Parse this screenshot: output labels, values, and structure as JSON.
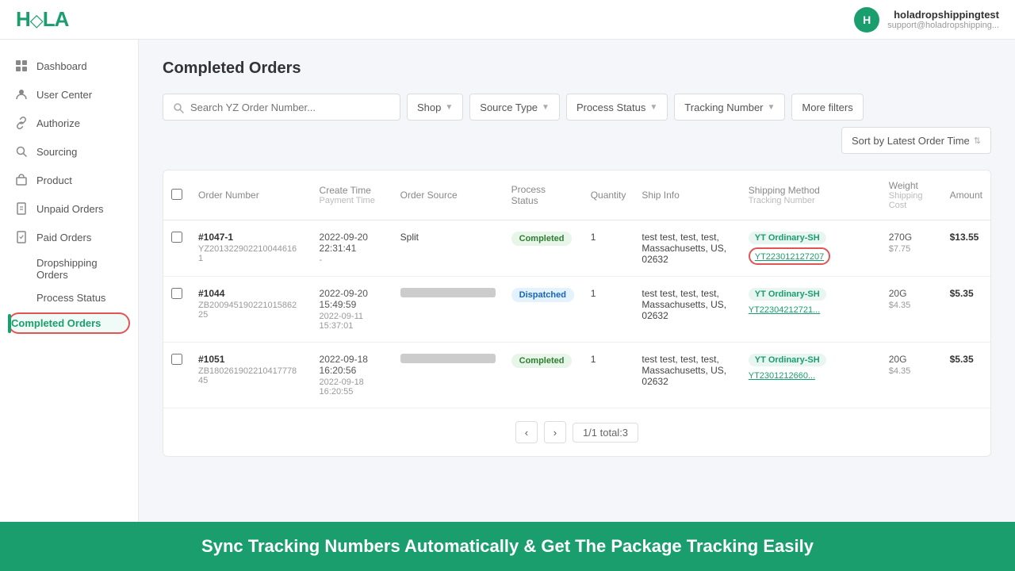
{
  "topbar": {
    "logo": "HOLA",
    "user": {
      "initial": "H",
      "name": "holadropshippingtest",
      "email": "support@holadropshipping..."
    }
  },
  "sidebar": {
    "items": [
      {
        "id": "dashboard",
        "label": "Dashboard",
        "icon": "grid"
      },
      {
        "id": "user-center",
        "label": "User Center",
        "icon": "user"
      },
      {
        "id": "authorize",
        "label": "Authorize",
        "icon": "link"
      },
      {
        "id": "sourcing",
        "label": "Sourcing",
        "icon": "search"
      },
      {
        "id": "product",
        "label": "Product",
        "icon": "box"
      },
      {
        "id": "unpaid-orders",
        "label": "Unpaid Orders",
        "icon": "file"
      },
      {
        "id": "paid-orders",
        "label": "Paid Orders",
        "icon": "check-file"
      }
    ],
    "sub_items": [
      {
        "id": "dropshipping-orders",
        "label": "Dropshipping Orders"
      },
      {
        "id": "process-status",
        "label": "Process Status"
      },
      {
        "id": "completed-orders",
        "label": "Completed Orders",
        "active": true
      }
    ]
  },
  "page": {
    "title": "Completed Orders"
  },
  "filters": {
    "search_placeholder": "Search YZ Order Number...",
    "shop_label": "Shop",
    "source_type_label": "Source Type",
    "process_status_label": "Process Status",
    "tracking_number_label": "Tracking Number",
    "more_filters_label": "More filters",
    "sort_label": "Sort by Latest Order Time"
  },
  "table": {
    "headers": {
      "order_number": "Order Number",
      "create_time": "Create Time",
      "payment_time": "Payment Time",
      "order_source": "Order Source",
      "process_status": "Process Status",
      "quantity": "Quantity",
      "ship_info": "Ship Info",
      "shipping_method": "Shipping Method",
      "tracking_number": "Tracking Number",
      "weight": "Weight",
      "shipping_cost": "Shipping Cost",
      "amount": "Amount"
    },
    "rows": [
      {
        "order_num": "#1047-1",
        "order_id": "YZ201322902210044616 1",
        "create_time": "2022-09-20 22:31:41",
        "payment_time": "-",
        "order_source": "Split",
        "status": "Completed",
        "status_type": "completed",
        "quantity": "1",
        "ship_info": "test test, test, test, Massachusetts, US, 02632",
        "ship_method": "YT Ordinary-SH",
        "tracking_num": "YT223012127207",
        "tracking_highlighted": true,
        "weight": "270G",
        "shipping_cost": "$7.75",
        "amount": "$13.55"
      },
      {
        "order_num": "#1044",
        "order_id": "ZB200945190221015862 25",
        "create_time": "2022-09-20 15:49:59",
        "payment_time": "2022-09-11 15:37:01",
        "order_source": "blurred",
        "status": "Dispatched",
        "status_type": "dispatched",
        "quantity": "1",
        "ship_info": "test test, test, test, Massachusetts, US, 02632",
        "ship_method": "YT Ordinary-SH",
        "tracking_num": "YT22304212721...",
        "tracking_highlighted": false,
        "weight": "20G",
        "shipping_cost": "$4.35",
        "amount": "$5.35"
      },
      {
        "order_num": "#1051",
        "order_id": "ZB180261902210417778 45",
        "create_time": "2022-09-18 16:20:56",
        "payment_time": "2022-09-18 16:20:55",
        "order_source": "blurred",
        "status": "Completed",
        "status_type": "completed",
        "quantity": "1",
        "ship_info": "test test, test, test, Massachusetts, US, 02632",
        "ship_method": "YT Ordinary-SH",
        "tracking_num": "YT2301212660...",
        "tracking_highlighted": false,
        "weight": "20G",
        "shipping_cost": "$4.35",
        "amount": "$5.35"
      }
    ]
  },
  "pagination": {
    "prev_label": "‹",
    "next_label": "›",
    "info": "1/1 total:3"
  },
  "banner": {
    "text": "Sync Tracking Numbers Automatically & Get The Package Tracking Easily"
  }
}
